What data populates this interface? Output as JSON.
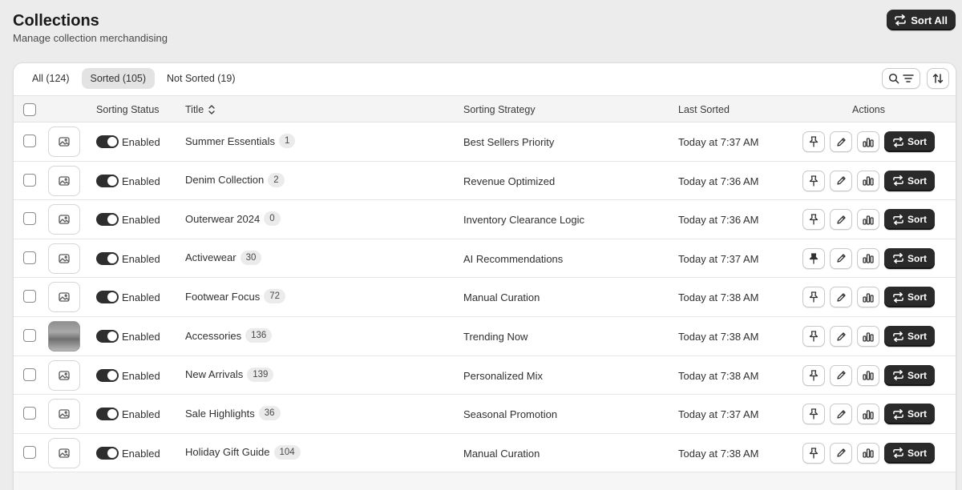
{
  "header": {
    "title": "Collections",
    "subtitle": "Manage collection merchandising",
    "sort_all_label": "Sort All"
  },
  "tabs": [
    {
      "label": "All (124)",
      "active": false
    },
    {
      "label": "Sorted (105)",
      "active": true
    },
    {
      "label": "Not Sorted (19)",
      "active": false
    }
  ],
  "toolbar": {
    "search_filter_icon": "search-filter-icon",
    "sort_order_icon": "sort-order-icon"
  },
  "columns": {
    "status": "Sorting Status",
    "title": "Title",
    "strategy": "Sorting Strategy",
    "last_sorted": "Last Sorted",
    "actions": "Actions"
  },
  "rows": [
    {
      "status": "Enabled",
      "title": "Summer Essentials",
      "count": "1",
      "strategy": "Best Sellers Priority",
      "last_sorted": "Today at 7:37 AM",
      "pinned": false,
      "thumb": "placeholder"
    },
    {
      "status": "Enabled",
      "title": "Denim Collection",
      "count": "2",
      "strategy": "Revenue Optimized",
      "last_sorted": "Today at 7:36 AM",
      "pinned": false,
      "thumb": "placeholder"
    },
    {
      "status": "Enabled",
      "title": "Outerwear 2024",
      "count": "0",
      "strategy": "Inventory Clearance Logic",
      "last_sorted": "Today at 7:36 AM",
      "pinned": false,
      "thumb": "placeholder"
    },
    {
      "status": "Enabled",
      "title": "Activewear",
      "count": "30",
      "strategy": "AI Recommendations",
      "last_sorted": "Today at 7:37 AM",
      "pinned": true,
      "thumb": "placeholder"
    },
    {
      "status": "Enabled",
      "title": "Footwear Focus",
      "count": "72",
      "strategy": "Manual Curation",
      "last_sorted": "Today at 7:38 AM",
      "pinned": false,
      "thumb": "placeholder"
    },
    {
      "status": "Enabled",
      "title": "Accessories",
      "count": "136",
      "strategy": "Trending Now",
      "last_sorted": "Today at 7:38 AM",
      "pinned": false,
      "thumb": "photo"
    },
    {
      "status": "Enabled",
      "title": "New Arrivals",
      "count": "139",
      "strategy": "Personalized Mix",
      "last_sorted": "Today at 7:38 AM",
      "pinned": false,
      "thumb": "placeholder"
    },
    {
      "status": "Enabled",
      "title": "Sale Highlights",
      "count": "36",
      "strategy": "Seasonal Promotion",
      "last_sorted": "Today at 7:37 AM",
      "pinned": false,
      "thumb": "placeholder"
    },
    {
      "status": "Enabled",
      "title": "Holiday Gift Guide",
      "count": "104",
      "strategy": "Manual Curation",
      "last_sorted": "Today at 7:38 AM",
      "pinned": false,
      "thumb": "placeholder"
    }
  ],
  "row_action_sort_label": "Sort",
  "colors": {
    "background": "#ececec",
    "primary_button": "#2a2a2a",
    "toggle_on": "#2e2e2e"
  }
}
